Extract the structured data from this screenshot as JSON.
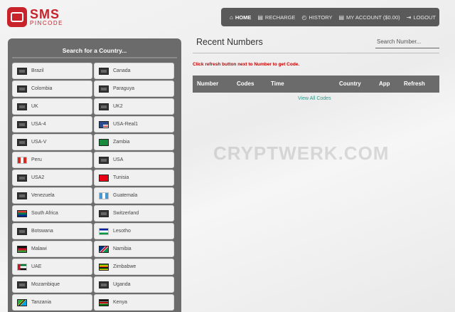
{
  "logo": {
    "main": "SMS",
    "sub": "PINCODE"
  },
  "nav": [
    {
      "label": "HOME",
      "icon": "home-icon",
      "glyph": "⌂",
      "active": true
    },
    {
      "label": "RECHARGE",
      "icon": "cart-icon",
      "glyph": "▤",
      "active": false
    },
    {
      "label": "HISTORY",
      "icon": "clock-icon",
      "glyph": "◴",
      "active": false
    },
    {
      "label": "MY ACCOUNT ($0.00)",
      "icon": "cart-icon",
      "glyph": "▤",
      "active": false
    },
    {
      "label": "LOGOUT",
      "icon": "logout-icon",
      "glyph": "⇥",
      "active": false
    }
  ],
  "left_panel": {
    "title": "Search for a Country..."
  },
  "countries": [
    {
      "name": "Brazil",
      "flag": "generic"
    },
    {
      "name": "Canada",
      "flag": "generic"
    },
    {
      "name": "Colombia",
      "flag": "generic"
    },
    {
      "name": "Paraguya",
      "flag": "generic"
    },
    {
      "name": "UK",
      "flag": "generic"
    },
    {
      "name": "UK2",
      "flag": "generic"
    },
    {
      "name": "USA-4",
      "flag": "generic"
    },
    {
      "name": "USA-Real1",
      "flag": "usa"
    },
    {
      "name": "USA-V",
      "flag": "generic"
    },
    {
      "name": "Zambia",
      "flag": "zambia"
    },
    {
      "name": "Peru",
      "flag": "peru"
    },
    {
      "name": "USA",
      "flag": "generic"
    },
    {
      "name": "USA2",
      "flag": "generic"
    },
    {
      "name": "Tunisia",
      "flag": "tunisia"
    },
    {
      "name": "Venezuela",
      "flag": "generic"
    },
    {
      "name": "Guatemala",
      "flag": "guatemala"
    },
    {
      "name": "South Africa",
      "flag": "southafrica"
    },
    {
      "name": "Switzerland",
      "flag": "generic"
    },
    {
      "name": "Botswana",
      "flag": "generic"
    },
    {
      "name": "Lesotho",
      "flag": "lesotho"
    },
    {
      "name": "Malawi",
      "flag": "malawi"
    },
    {
      "name": "Namibia",
      "flag": "namibia"
    },
    {
      "name": "UAE",
      "flag": "uae"
    },
    {
      "name": "Zimbabwe",
      "flag": "zimbabwe"
    },
    {
      "name": "Mozambique",
      "flag": "generic"
    },
    {
      "name": "Uganda",
      "flag": "generic"
    },
    {
      "name": "Tanzania",
      "flag": "tanzania"
    },
    {
      "name": "Kenya",
      "flag": "kenya"
    }
  ],
  "main": {
    "title": "Recent Numbers",
    "search_placeholder": "Search Number...",
    "notice": "Click refresh button next to Number to get Code.",
    "columns": [
      "Number",
      "Codes",
      "Time",
      "Country",
      "App",
      "Refresh"
    ],
    "view_all": "View All Codes"
  },
  "watermark": "CRYPTWERK.COM",
  "colors": {
    "brand": "#c8222a",
    "nav_bg": "#5a5a5a",
    "panel_bg": "#6b6b6b",
    "notice": "#c00000",
    "link": "#2a9d8f"
  }
}
